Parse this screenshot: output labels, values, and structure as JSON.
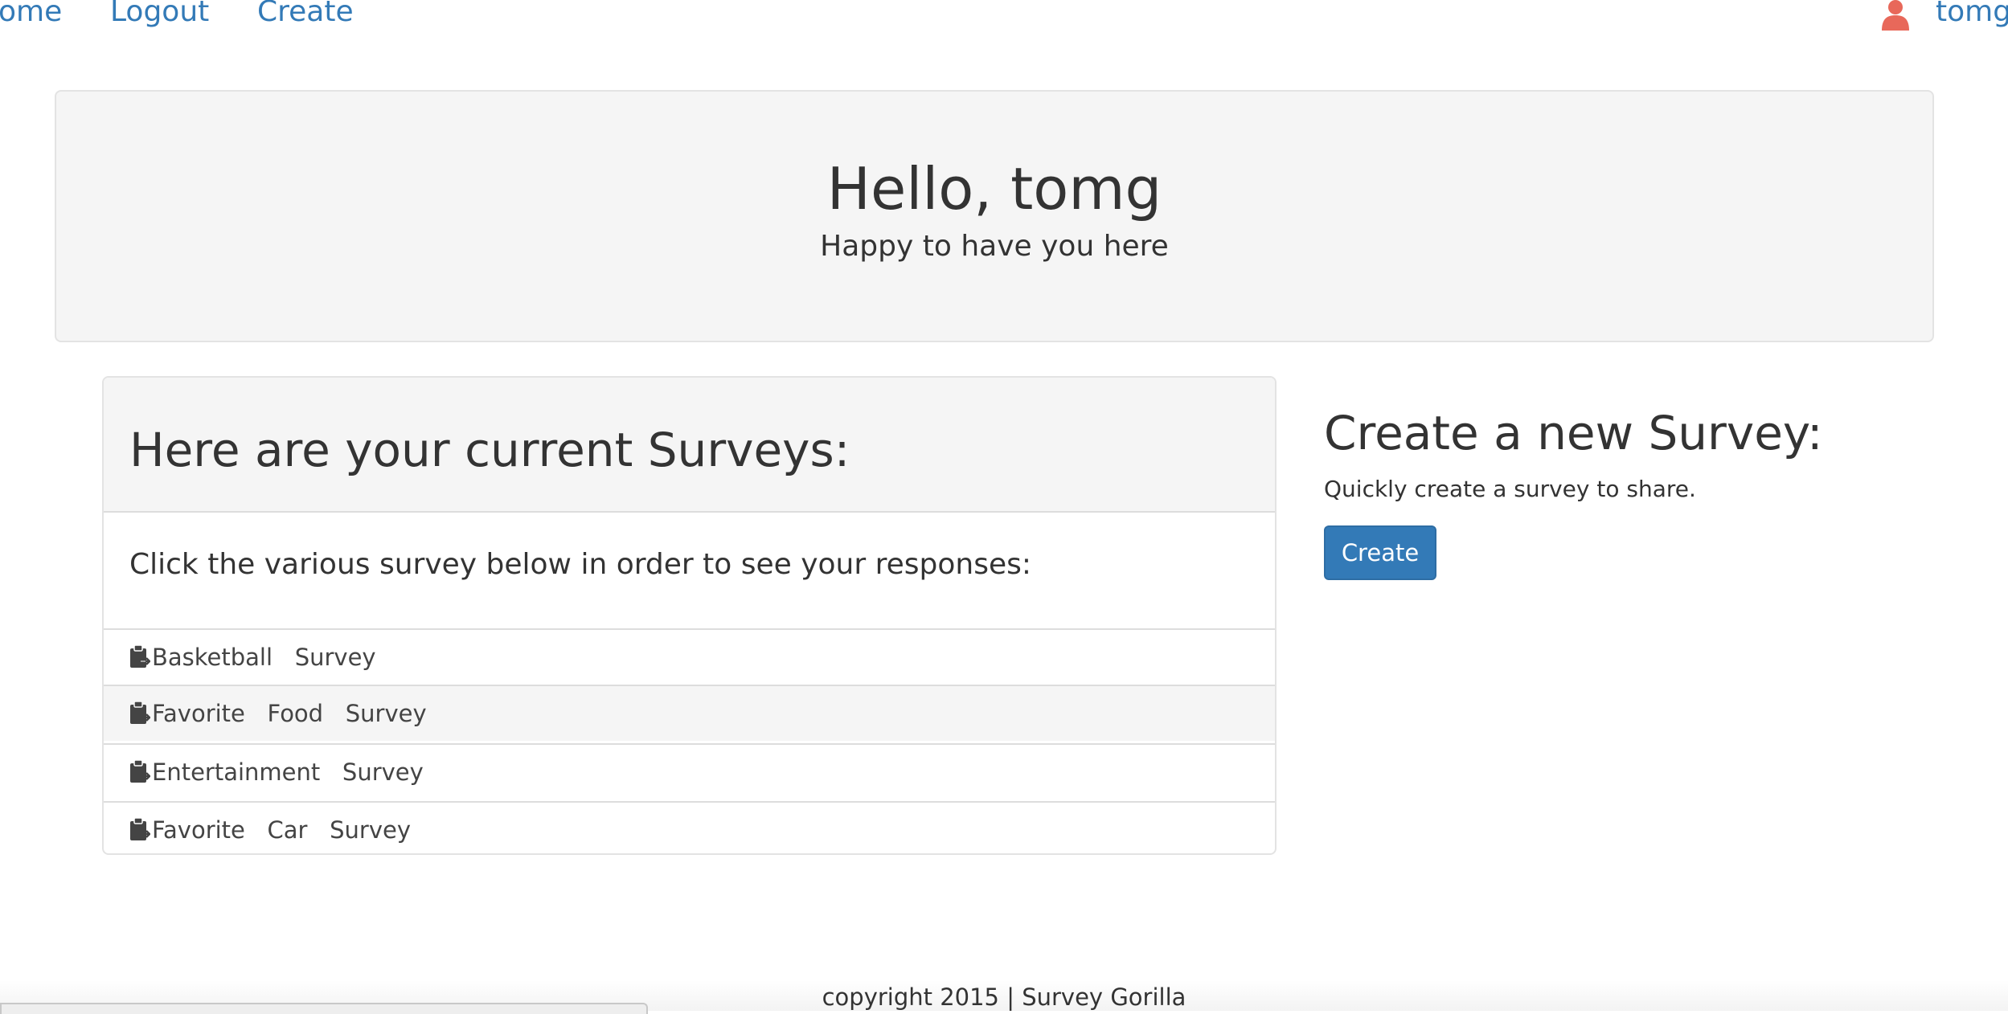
{
  "nav": {
    "items": [
      {
        "label": "ome"
      },
      {
        "label": "Logout"
      },
      {
        "label": "Create"
      }
    ],
    "user": {
      "name": "tomg",
      "icon": "user-icon"
    }
  },
  "jumbotron": {
    "title": "Hello, tomg",
    "subtitle": "Happy to have you here"
  },
  "surveys_panel": {
    "heading": "Here are your current Surveys:",
    "description": "Click the various survey below in order to see your responses:",
    "items": [
      {
        "label": "Basketball   Survey",
        "icon": "clipboard-icon"
      },
      {
        "label": "Favorite   Food   Survey",
        "icon": "clipboard-icon"
      },
      {
        "label": "Entertainment   Survey",
        "icon": "clipboard-icon"
      },
      {
        "label": "Favorite   Car   Survey",
        "icon": "clipboard-icon"
      }
    ]
  },
  "create_section": {
    "title": "Create a new Survey:",
    "subtitle": "Quickly create a survey to share.",
    "button_label": "Create"
  },
  "footer": {
    "text": "copyright 2015 | Survey Gorilla"
  },
  "colors": {
    "link": "#337ab7",
    "button": "#337ab7",
    "user_icon": "#e8685a",
    "panel_bg": "#f5f5f5"
  }
}
